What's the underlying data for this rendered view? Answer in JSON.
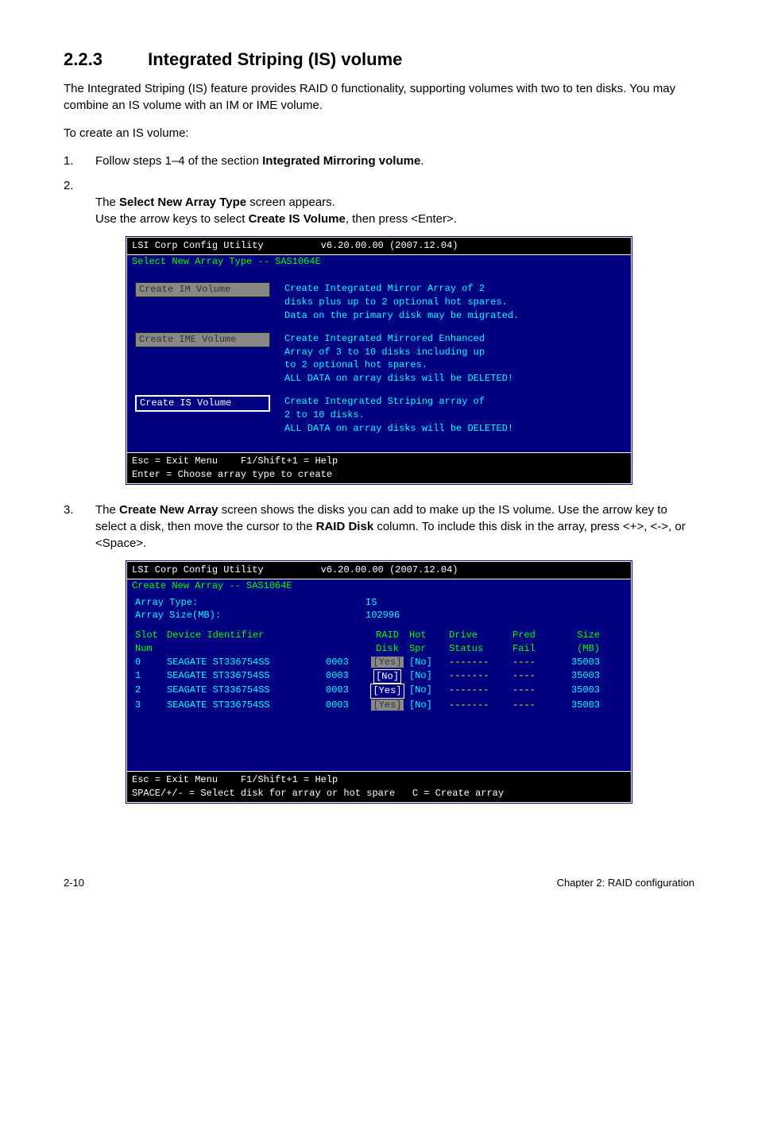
{
  "section": {
    "number": "2.2.3",
    "title": "Integrated Striping (IS) volume"
  },
  "intro": "The Integrated Striping (IS) feature provides RAID 0 functionality, supporting volumes with two to ten disks. You may combine an IS volume with an IM or IME volume.",
  "lead": "To create an IS volume:",
  "steps": {
    "s1": {
      "num": "1.",
      "pre": "Follow steps 1–4 of the section ",
      "bold": "Integrated Mirroring volume",
      "post": "."
    },
    "s2": {
      "num": "2.",
      "pre": "The ",
      "bold": "Select New Array Type",
      "mid": " screen appears.\nUse the arrow keys to select ",
      "bold2": "Create IS Volume",
      "post": ", then press <Enter>."
    },
    "s3": {
      "num": "3.",
      "pre": "The ",
      "bold": "Create New Array",
      "mid": " screen shows the disks you can add to make up the IS volume. Use the arrow key to select a disk, then move the cursor to the ",
      "bold2": "RAID Disk",
      "post": " column. To include this disk in the array, press <+>, <->, or <Space>."
    }
  },
  "bios1": {
    "title": "LSI Corp Config Utility",
    "version": "v6.20.00.00 (2007.12.04)",
    "subhead": "Select New Array Type -- SAS1064E",
    "opt_im": {
      "label": "Create IM Volume",
      "desc": "Create Integrated Mirror Array of 2\ndisks plus up to 2 optional hot spares.\nData on the primary disk may be migrated."
    },
    "opt_ime": {
      "label": "Create IME Volume",
      "desc": "Create Integrated Mirrored Enhanced\nArray of 3 to 10 disks including up\nto 2 optional hot spares.\nALL DATA on array disks will be DELETED!"
    },
    "opt_is": {
      "label": "Create IS Volume",
      "desc": "Create Integrated Striping array of\n2 to 10 disks.\nALL DATA on array disks will be DELETED!"
    },
    "footer": "Esc = Exit Menu    F1/Shift+1 = Help\nEnter = Choose array type to create"
  },
  "bios2": {
    "title": "LSI Corp Config Utility",
    "version": "v6.20.00.00 (2007.12.04)",
    "subhead": "Create New Array -- SAS1064E",
    "arrtype_lbl": "Array Type:",
    "arrtype_val": "IS",
    "arrsize_lbl": "Array Size(MB):",
    "arrsize_val": "102996",
    "hdr": {
      "slot": "Slot",
      "num": "Num",
      "dev": "Device Identifier",
      "raid": "RAID",
      "disk": "Disk",
      "hot": "Hot",
      "spr": "Spr",
      "drv": "Drive",
      "stat": "Status",
      "pred": "Pred",
      "fail": "Fail",
      "size": "Size",
      "mb": "(MB)"
    },
    "rows": [
      {
        "slot": "0",
        "dev": "SEAGATE ST336754SS",
        "code": "0003",
        "raid": "[Yes]",
        "hot": "[No]",
        "drv": "-------",
        "pred": "----",
        "size": "35003",
        "hl": "dim"
      },
      {
        "slot": "1",
        "dev": "SEAGATE ST336754SS",
        "code": "0003",
        "raid": "[No]",
        "hot": "[No]",
        "drv": "-------",
        "pred": "----",
        "size": "35003",
        "hl": "sel"
      },
      {
        "slot": "2",
        "dev": "SEAGATE ST336754SS",
        "code": "0003",
        "raid": "[Yes]",
        "hot": "[No]",
        "drv": "-------",
        "pred": "----",
        "size": "35003",
        "hl": "sel"
      },
      {
        "slot": "3",
        "dev": "SEAGATE ST336754SS",
        "code": "0003",
        "raid": "[Yes]",
        "hot": "[No]",
        "drv": "-------",
        "pred": "----",
        "size": "35003",
        "hl": "dim"
      }
    ],
    "footer": "Esc = Exit Menu    F1/Shift+1 = Help\nSPACE/+/- = Select disk for array or hot spare   C = Create array"
  },
  "pagefoot": {
    "left": "2-10",
    "right": "Chapter 2: RAID configuration"
  }
}
